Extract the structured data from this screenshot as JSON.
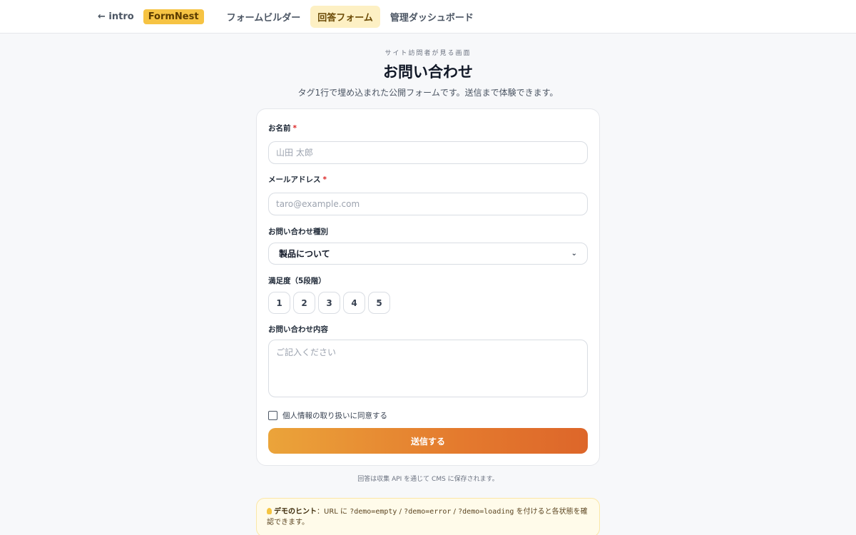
{
  "nav": {
    "back_label": "← intro",
    "brand": "FormNest",
    "tabs": [
      {
        "label": "フォームビルダー",
        "active": false
      },
      {
        "label": "回答フォーム",
        "active": true
      },
      {
        "label": "管理ダッシュボード",
        "active": false
      }
    ]
  },
  "header": {
    "eyebrow": "サイト訪問者が見る画面",
    "title": "お問い合わせ",
    "subtitle": "タグ1行で埋め込まれた公開フォームです。送信まで体験できます。"
  },
  "form": {
    "name": {
      "label": "お名前",
      "required_mark": "*",
      "placeholder": "山田 太郎",
      "value": ""
    },
    "email": {
      "label": "メールアドレス",
      "required_mark": "*",
      "placeholder": "taro@example.com",
      "value": ""
    },
    "inquiry_type": {
      "label": "お問い合わせ種別",
      "selected": "製品について"
    },
    "rating": {
      "label": "満足度（5段階）",
      "options": [
        "1",
        "2",
        "3",
        "4",
        "5"
      ],
      "selected": null
    },
    "message": {
      "label": "お問い合わせ内容",
      "placeholder": "ご記入ください",
      "value": ""
    },
    "consent": {
      "label": "個人情報の取り扱いに同意する",
      "checked": false
    },
    "submit_label": "送信する"
  },
  "footnote": "回答は収集 API を通じて CMS に保存されます。",
  "hint": {
    "title": "デモのヒント",
    "text_before": "：URL に ",
    "param1": "?demo=empty",
    "sep1": " / ",
    "param2": "?demo=error",
    "sep2": " / ",
    "param3": "?demo=loading",
    "text_after": " を付けると各状態を確認できます。"
  },
  "colors": {
    "brand_badge": "#f6c343",
    "active_tab": "#fdf0c4",
    "submit_gradient_start": "#eba43a",
    "submit_gradient_end": "#dd662a",
    "required": "#dc2626",
    "hint_bg": "#fffbea"
  }
}
